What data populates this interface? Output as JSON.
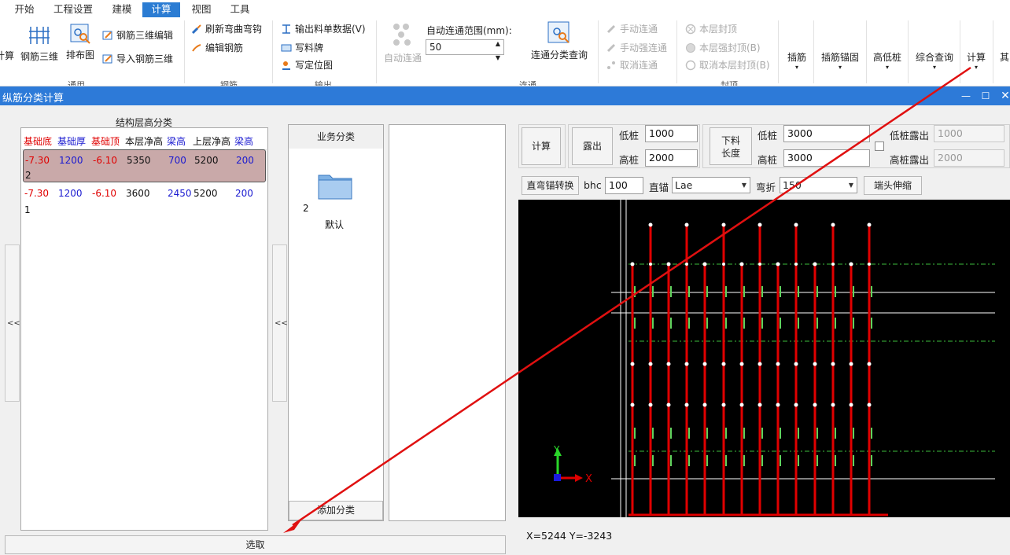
{
  "tabs": [
    "开始",
    "工程设置",
    "建模",
    "计算",
    "视图",
    "工具"
  ],
  "active_tab": "计算",
  "ribbon": {
    "calc_partial": "计算",
    "rebar3d": "钢筋三维",
    "layout_map": "排布图",
    "rebar3d_edit": "钢筋三维编辑",
    "import_rebar3d": "导入钢筋三维",
    "group_general": "通用",
    "refresh_bend_hook": "刷新弯曲弯钩",
    "edit_rebar": "编辑钢筋",
    "group_rebar": "钢筋",
    "export_bom": "输出料单数据(V)",
    "write_tag": "写料牌",
    "write_location_map": "写定位图",
    "group_output": "输出",
    "auto_connect": "自动连通",
    "auto_connect_range_label": "自动连通范围(mm):",
    "auto_connect_range_value": "50",
    "connect_category_query": "连通分类查询",
    "group_connect": "连通",
    "manual_connect": "手动连通",
    "manual_force_connect": "手动强连通",
    "cancel_connect": "取消连通",
    "layer_seal_top": "本层封顶",
    "layer_force_seal_top": "本层强封顶(B)",
    "cancel_layer_seal_top": "取消本层封顶(B)",
    "group_seal": "封顶",
    "insert_rebar": "插筋",
    "insert_anchor": "插筋锚固",
    "high_low_pile": "高低桩",
    "combined_query": "综合查询",
    "calculate": "计算",
    "other": "其"
  },
  "dialog": {
    "title": "纵筋分类计算",
    "collapse_left": "<<",
    "collapse_mid": "<<",
    "left_panel": {
      "title": "结构层高分类",
      "headers": [
        "基础底",
        "基础厚",
        "基础顶",
        "本层净高",
        "梁高",
        "上层净高",
        "梁高"
      ],
      "rows": [
        {
          "values": [
            "-7.30",
            "1200",
            "-6.10",
            "5350",
            "700",
            "5200",
            "200"
          ],
          "count": "2"
        },
        {
          "values": [
            "-7.30",
            "1200",
            "-6.10",
            "3600",
            "2450",
            "5200",
            "200"
          ],
          "count": "1"
        }
      ]
    },
    "business_panel": {
      "title": "业务分类",
      "item_count": "2",
      "item_label": "默认",
      "add_button": "添加分类"
    },
    "select_button": "选取",
    "controls": {
      "calc_button": "计算",
      "exposed_label": "露出",
      "low_pile_label": "低桩",
      "low_pile_value": "1000",
      "high_pile_label": "高桩",
      "high_pile_value": "2000",
      "cut_length_label": [
        "下料",
        "长度"
      ],
      "cut_low_label": "低桩",
      "cut_low_value": "3000",
      "cut_high_label": "高桩",
      "cut_high_value": "3000",
      "low_exposed_label": "低桩露出",
      "low_exposed_value": "1000",
      "high_exposed_label": "高桩露出",
      "high_exposed_value": "2000",
      "convert_anchor_button": "直弯锚转换",
      "bhc_label": "bhc",
      "bhc_value": "100",
      "straight_anchor_label": "直锚",
      "straight_anchor_value": "Lae",
      "bend_label": "弯折",
      "bend_value": "150",
      "end_stretch_button": "端头伸缩"
    },
    "axis": {
      "x": "X",
      "y": "Y"
    },
    "coords": "X=5244  Y=-3243"
  },
  "colors": {
    "accent": "#2b7cd3",
    "title_bar": "#2d7ad8",
    "rebar": "#e00000",
    "selected_row": "#c9a9a9",
    "annotation_arrow": "#e01010"
  }
}
